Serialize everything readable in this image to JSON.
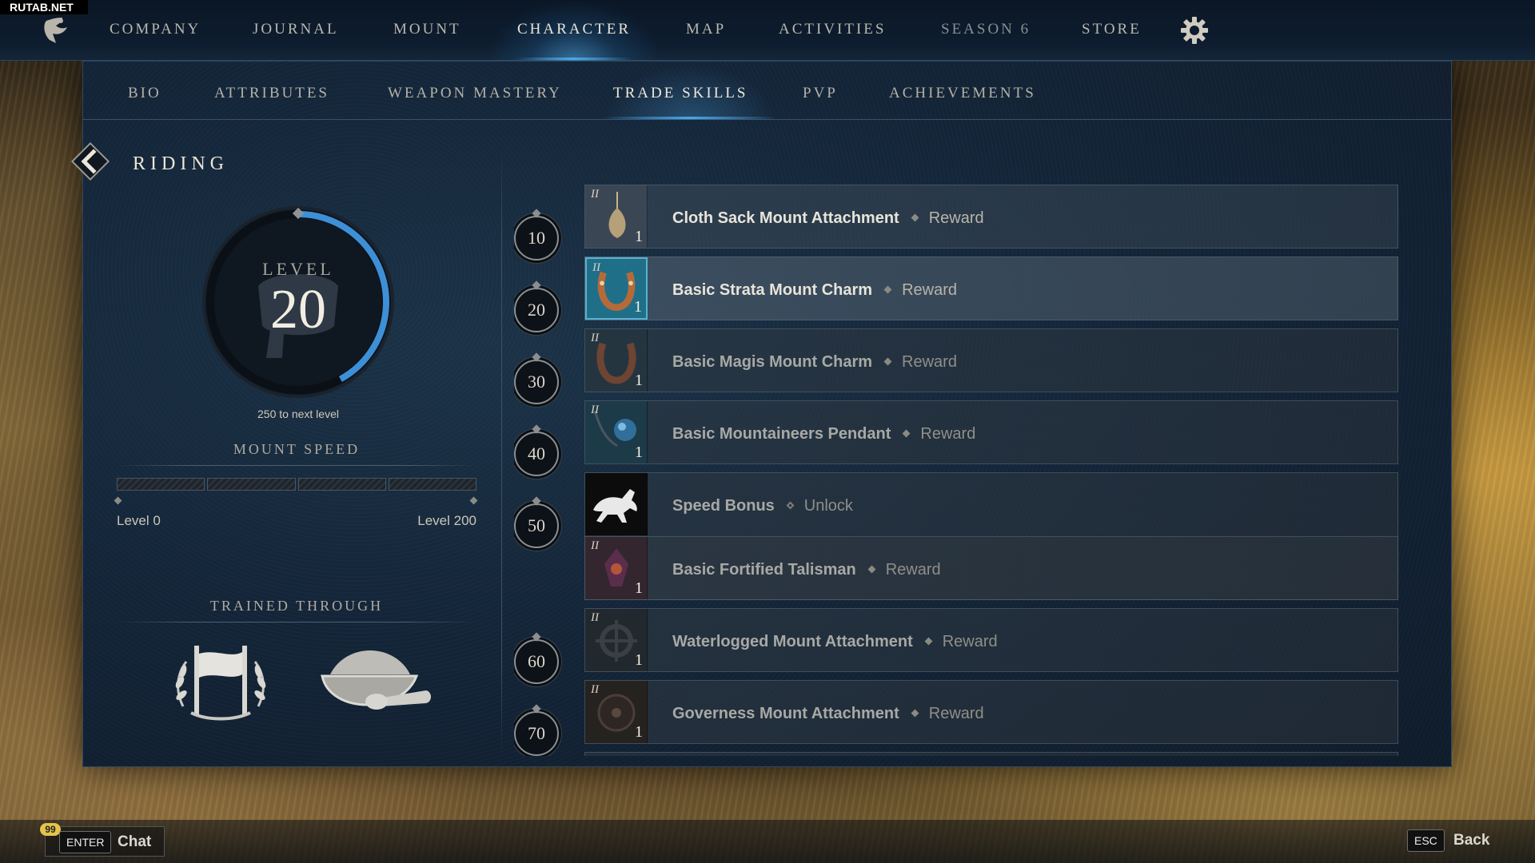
{
  "watermark": "RUTAB.NET",
  "topnav": {
    "items": [
      {
        "label": "COMPANY"
      },
      {
        "label": "JOURNAL"
      },
      {
        "label": "MOUNT"
      },
      {
        "label": "CHARACTER"
      },
      {
        "label": "MAP"
      },
      {
        "label": "ACTIVITIES"
      },
      {
        "label": "SEASON 6"
      },
      {
        "label": "STORE"
      }
    ],
    "active": "CHARACTER",
    "settings_icon": "gear-icon"
  },
  "subnav": {
    "items": [
      {
        "label": "BIO"
      },
      {
        "label": "ATTRIBUTES"
      },
      {
        "label": "WEAPON MASTERY"
      },
      {
        "label": "TRADE SKILLS"
      },
      {
        "label": "PVP"
      },
      {
        "label": "ACHIEVEMENTS"
      }
    ],
    "active": "TRADE SKILLS"
  },
  "skill": {
    "title": "RIDING",
    "level_label": "LEVEL",
    "level": "20",
    "progress_fraction": 0.42,
    "next_level_text": "250 to next level"
  },
  "mount_speed": {
    "heading": "MOUNT SPEED",
    "range_min": "Level 0",
    "range_max": "Level 200",
    "fill_fraction": 0.0
  },
  "trained_through": {
    "heading": "TRAINED THROUGH",
    "icons": [
      "banner-laurel-icon",
      "feed-bowl-icon"
    ]
  },
  "rewards": [
    {
      "milestone": "10",
      "name": "Cloth Sack Mount Attachment",
      "kind": "Reward",
      "tier": "II",
      "qty": "1",
      "icon": "sack-icon",
      "state": "normal"
    },
    {
      "milestone": "20",
      "name": "Basic Strata Mount Charm",
      "kind": "Reward",
      "tier": "II",
      "qty": "1",
      "icon": "horseshoe-icon",
      "state": "highlight"
    },
    {
      "milestone": "30",
      "name": "Basic Magis Mount Charm",
      "kind": "Reward",
      "tier": "II",
      "qty": "1",
      "icon": "horseshoe-icon",
      "state": "dim"
    },
    {
      "milestone": "40",
      "name": "Basic Mountaineers Pendant",
      "kind": "Reward",
      "tier": "II",
      "qty": "1",
      "icon": "pendant-icon",
      "state": "dim"
    },
    {
      "milestone": "50",
      "name": "Speed Bonus",
      "kind": "Unlock",
      "tier": "",
      "qty": "",
      "icon": "running-horse-icon",
      "state": "dim"
    },
    {
      "milestone": "",
      "name": "Basic Fortified Talisman",
      "kind": "Reward",
      "tier": "II",
      "qty": "1",
      "icon": "talisman-icon",
      "state": "dim"
    },
    {
      "milestone": "60",
      "name": "Waterlogged Mount Attachment",
      "kind": "Reward",
      "tier": "II",
      "qty": "1",
      "icon": "anchor-wheel-icon",
      "state": "dim"
    },
    {
      "milestone": "70",
      "name": "Governess Mount Attachment",
      "kind": "Reward",
      "tier": "II",
      "qty": "1",
      "icon": "shield-icon",
      "state": "dim"
    }
  ],
  "bottombar": {
    "chat_badge": "99",
    "chat_key": "ENTER",
    "chat_label": "Chat",
    "back_key": "ESC",
    "back_label": "Back"
  },
  "colors": {
    "accent_blue": "#3d8fd6",
    "panel_bg": "#14263a",
    "text_primary": "#e8e4da"
  }
}
